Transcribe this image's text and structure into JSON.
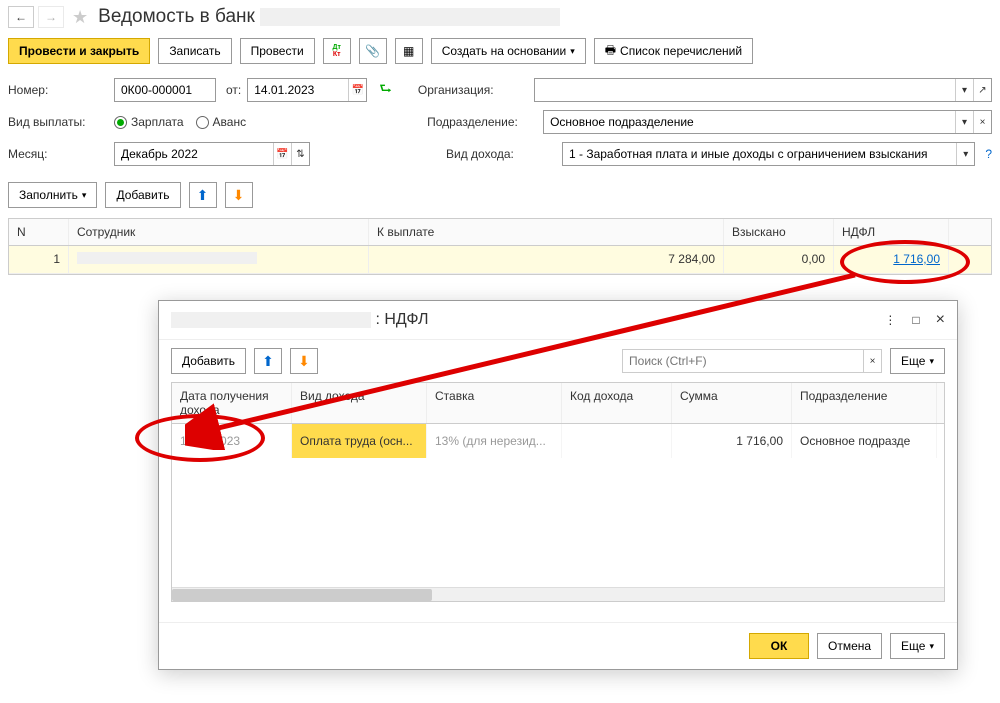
{
  "header": {
    "title": "Ведомость в банк"
  },
  "actions": {
    "post_close": "Провести и закрыть",
    "save": "Записать",
    "post": "Провести",
    "create_based": "Создать на основании",
    "transfer_list": "Список перечислений"
  },
  "fields": {
    "number_label": "Номер:",
    "number_value": "0К00-000001",
    "date_label": "от:",
    "date_value": "14.01.2023",
    "org_label": "Организация:",
    "org_value": "",
    "payment_type_label": "Вид выплаты:",
    "salary": "Зарплата",
    "advance": "Аванс",
    "dept_label": "Подразделение:",
    "dept_value": "Основное подразделение",
    "month_label": "Месяц:",
    "month_value": "Декабрь 2022",
    "income_type_label": "Вид дохода:",
    "income_type_value": "1 - Заработная плата и иные доходы с ограничением взыскания"
  },
  "fill_toolbar": {
    "fill": "Заполнить",
    "add": "Добавить"
  },
  "table": {
    "headers": {
      "n": "N",
      "emp": "Сотрудник",
      "pay": "К выплате",
      "tax": "Взыскано",
      "ndfl": "НДФЛ"
    },
    "rows": [
      {
        "n": "1",
        "emp": "",
        "pay": "7 284,00",
        "tax": "0,00",
        "ndfl": "1 716,00"
      }
    ]
  },
  "popup": {
    "title_suffix": ": НДФЛ",
    "add": "Добавить",
    "search_placeholder": "Поиск (Ctrl+F)",
    "more": "Еще",
    "headers": {
      "date": "Дата получения дохода",
      "income": "Вид дохода",
      "rate": "Ставка",
      "code": "Код дохода",
      "sum": "Сумма",
      "dept": "Подразделение"
    },
    "row": {
      "date": "14.01.2023",
      "income": "Оплата труда (осн...",
      "rate": "13% (для нерезид...",
      "code": "",
      "sum": "1 716,00",
      "dept": "Основное подразде"
    },
    "ok": "ОК",
    "cancel": "Отмена"
  }
}
